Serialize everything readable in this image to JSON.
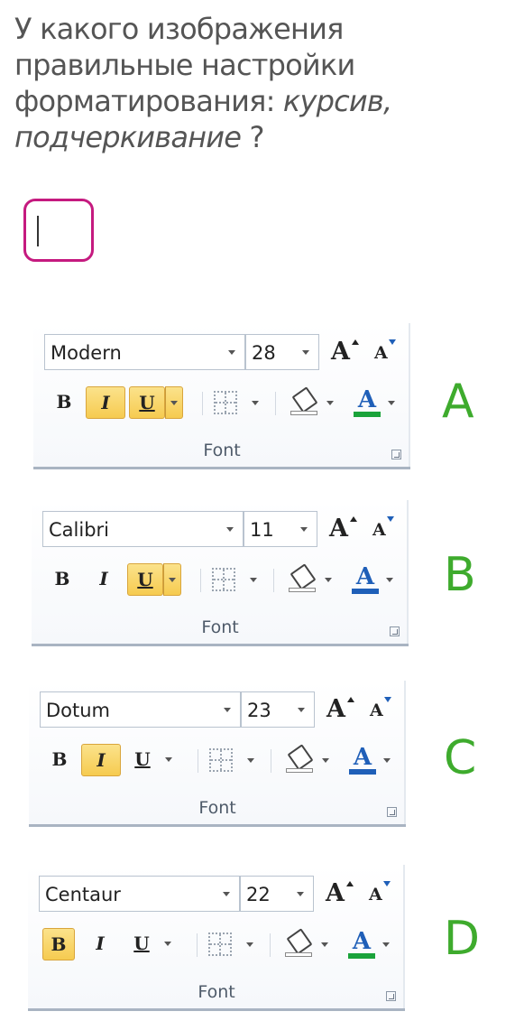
{
  "question": {
    "part1": "У какого изображения правильные настройки форматирования: ",
    "italic": "курсив, подчеркивание",
    "part2": " ?"
  },
  "answer": {
    "value": ""
  },
  "panels": [
    {
      "font": "Modern",
      "size": "28",
      "group": "Font",
      "letter": "A",
      "bold": false,
      "italic": true,
      "underline": true,
      "font_color": "#1aa33a"
    },
    {
      "font": "Calibri",
      "size": "11",
      "group": "Font",
      "letter": "B",
      "bold": false,
      "italic": false,
      "underline": true,
      "font_color": "#1f5fb8"
    },
    {
      "font": "Dotum",
      "size": "23",
      "group": "Font",
      "letter": "C",
      "bold": false,
      "italic": true,
      "underline": false,
      "font_color": "#1f5fb8"
    },
    {
      "font": "Centaur",
      "size": "22",
      "group": "Font",
      "letter": "D",
      "bold": true,
      "italic": false,
      "underline": false,
      "font_color": "#1aa33a"
    }
  ],
  "labels": {
    "bold": "B",
    "italic": "I",
    "underline": "U",
    "grow": "A",
    "shrink": "A",
    "color": "A"
  },
  "colors": {
    "accent": "#c51a7f",
    "letter": "#3eab2d",
    "highlight": "#f6cb50"
  },
  "icons": [
    "paint-bucket-icon",
    "borders-icon",
    "dialog-launcher-icon"
  ]
}
